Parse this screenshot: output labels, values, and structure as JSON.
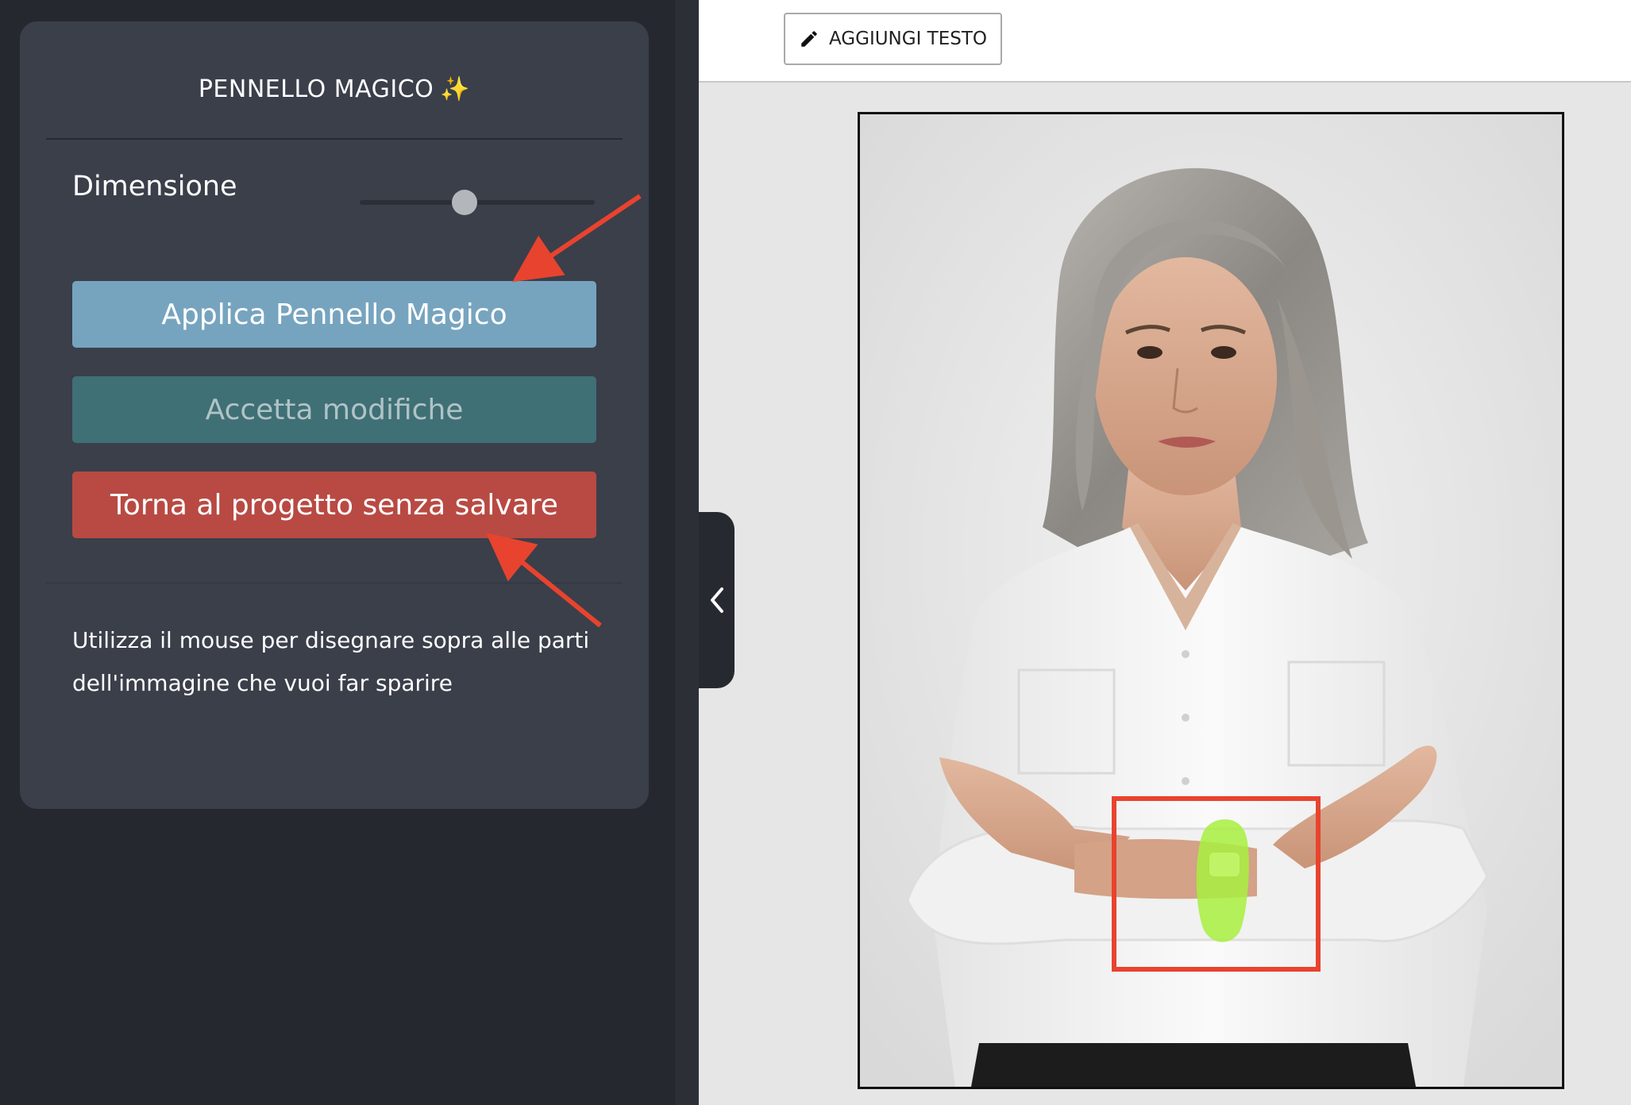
{
  "panel": {
    "title": "PENNELLO MAGICO",
    "title_emoji": "✨",
    "size_label": "Dimensione",
    "size_value_fraction": 0.44,
    "apply_button": "Applica Pennello Magico",
    "accept_button": "Accetta modifiche",
    "back_button": "Torna al progetto senza salvare",
    "help_text": "Utilizza il mouse per disegnare sopra alle parti dell'immagine che vuoi far sparire"
  },
  "toolbar": {
    "add_text_label": "AGGIUNGI TESTO",
    "add_text_icon": "pencil-icon"
  },
  "colors": {
    "sidebar_bg": "#25292f",
    "panel_bg": "#3a3f4a",
    "apply_bg": "#76a4bf",
    "accept_bg": "#3f7076",
    "back_bg": "#b84a43",
    "annotation_red": "#e8432f",
    "mask_green": "#a8f040"
  },
  "icons": {
    "collapse": "chevron-left-icon",
    "title_emoji": "sparkles-icon"
  }
}
